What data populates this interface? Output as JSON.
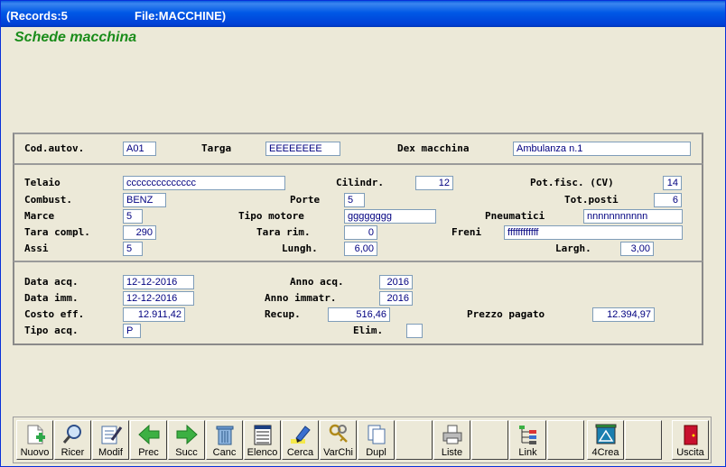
{
  "window": {
    "records": "(Records:5",
    "file": "File:MACCHINE)"
  },
  "form_title": "Schede macchina",
  "header": {
    "cod_autov": {
      "label": "Cod.autov.",
      "value": "A01"
    },
    "targa": {
      "label": "Targa",
      "value": "EEEEEEEE"
    },
    "dex": {
      "label": "Dex macchina",
      "value": "Ambulanza n.1"
    }
  },
  "specs": {
    "telaio": {
      "label": "Telaio",
      "value": "cccccccccccccc"
    },
    "cilindr": {
      "label": "Cilindr.",
      "value": "12"
    },
    "pot_fisc": {
      "label": "Pot.fisc. (CV)",
      "value": "14"
    },
    "combust": {
      "label": "Combust.",
      "value": "BENZ"
    },
    "porte": {
      "label": "Porte",
      "value": "5"
    },
    "tot_posti": {
      "label": "Tot.posti",
      "value": "6"
    },
    "marce": {
      "label": "Marce",
      "value": "5"
    },
    "tipo_motore": {
      "label": "Tipo motore",
      "value": "gggggggg"
    },
    "pneumatici": {
      "label": "Pneumatici",
      "value": "nnnnnnnnnnn"
    },
    "tara_compl": {
      "label": "Tara compl.",
      "value": "290"
    },
    "tara_rim": {
      "label": "Tara rim.",
      "value": "0"
    },
    "freni": {
      "label": "Freni",
      "value": "ffffffffffff"
    },
    "assi": {
      "label": "Assi",
      "value": "5"
    },
    "lungh": {
      "label": "Lungh.",
      "value": "6,00"
    },
    "largh": {
      "label": "Largh.",
      "value": "3,00"
    }
  },
  "purchase": {
    "data_acq": {
      "label": "Data acq.",
      "value": "12-12-2016"
    },
    "anno_acq": {
      "label": "Anno acq.",
      "value": "2016"
    },
    "data_imm": {
      "label": "Data imm.",
      "value": "12-12-2016"
    },
    "anno_immatr": {
      "label": "Anno immatr.",
      "value": "2016"
    },
    "costo_eff": {
      "label": "Costo eff.",
      "value": "12.911,42"
    },
    "recup": {
      "label": "Recup.",
      "value": "516,46"
    },
    "prezzo_pagato": {
      "label": "Prezzo pagato",
      "value": "12.394,97"
    },
    "tipo_acq": {
      "label": "Tipo acq.",
      "value": "P"
    },
    "elim": {
      "label": "Elim.",
      "value": ""
    }
  },
  "toolbar": {
    "nuovo": "Nuovo",
    "ricer": "Ricer",
    "modif": "Modif",
    "prec": "Prec",
    "succ": "Succ",
    "canc": "Canc",
    "elenco": "Elenco",
    "cerca": "Cerca",
    "varchi": "VarChi",
    "dupl": "Dupl",
    "liste": "Liste",
    "link": "Link",
    "crea": "4Crea",
    "uscita": "Uscita"
  },
  "icons": {
    "nuovo": "new-document-icon",
    "ricer": "magnifier-icon",
    "modif": "edit-document-icon",
    "prec": "arrow-left-icon",
    "succ": "arrow-right-icon",
    "canc": "trash-icon",
    "elenco": "list-icon",
    "cerca": "highlighter-icon",
    "varchi": "keys-icon",
    "dupl": "copy-icon",
    "liste": "printer-icon",
    "link": "tree-link-icon",
    "crea": "blueprint-icon",
    "uscita": "exit-door-icon"
  },
  "colors": {
    "title_green": "#1a8c1a",
    "field_text": "#000080",
    "titlebar_blue": "#0058e6"
  }
}
